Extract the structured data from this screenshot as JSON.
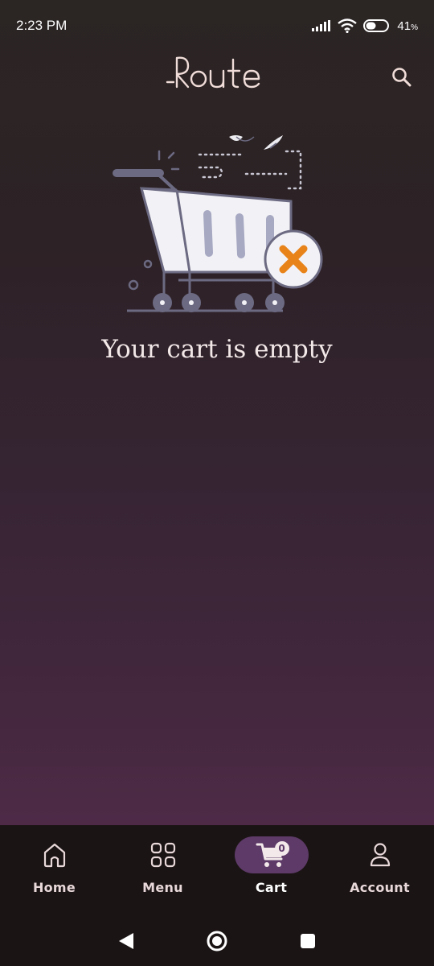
{
  "status_bar": {
    "time": "2:23 PM",
    "battery_percent": "41",
    "battery_unit": "%"
  },
  "header": {
    "logo_text": "Route",
    "icons": {
      "search": "search-icon"
    }
  },
  "empty_state": {
    "message": "Your cart is empty",
    "illustration": "empty-cart-icon"
  },
  "bottom_nav": {
    "items": [
      {
        "label": "Home",
        "icon": "home-icon",
        "active": false
      },
      {
        "label": "Menu",
        "icon": "grid-icon",
        "active": false
      },
      {
        "label": "Cart",
        "icon": "cart-icon",
        "active": true,
        "badge": "0"
      },
      {
        "label": "Account",
        "icon": "person-icon",
        "active": false
      }
    ]
  },
  "system_nav": {
    "icons": [
      "back-icon",
      "home-circle-icon",
      "recents-icon"
    ]
  },
  "colors": {
    "accent": "#5d3a68",
    "cancel_orange": "#e8831a",
    "text": "#f2e8e8"
  }
}
